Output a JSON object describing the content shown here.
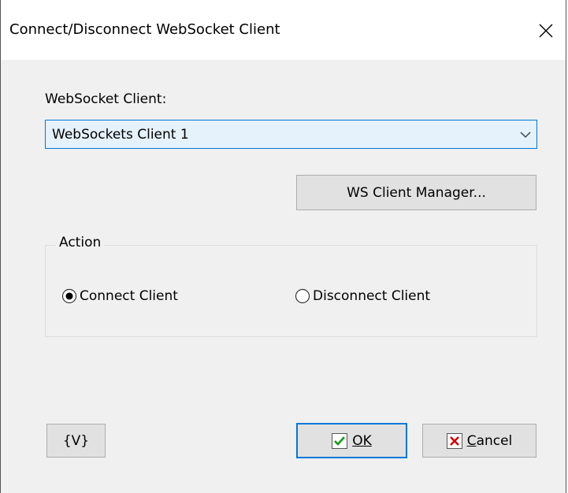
{
  "window": {
    "title": "Connect/Disconnect WebSocket Client",
    "close_icon": "close-icon"
  },
  "client": {
    "label": "WebSocket Client:",
    "selected": "WebSockets Client 1"
  },
  "manager_button": {
    "label": "WS Client Manager..."
  },
  "action": {
    "legend": "Action",
    "options": [
      {
        "label": "Connect Client",
        "checked": true
      },
      {
        "label": "Disconnect Client",
        "checked": false
      }
    ]
  },
  "footer": {
    "variables_label": "{V}",
    "ok_label": "OK",
    "cancel_label": "Cancel"
  },
  "colors": {
    "accent": "#0078d7",
    "ok_check": "#1a9a1a",
    "cancel_x": "#d40000"
  }
}
